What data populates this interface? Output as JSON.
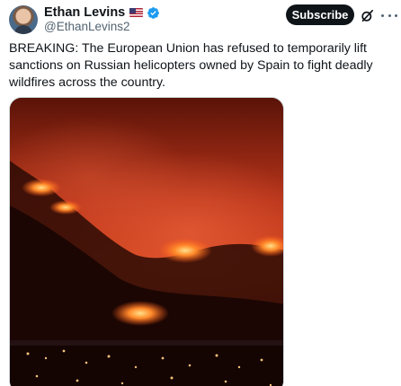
{
  "author": {
    "display_name": "Ethan Levins",
    "handle": "@EthanLevins2",
    "flag_icon": "us-flag-icon",
    "verified_icon": "verified-badge-icon",
    "verified_color": "#1d9bf0"
  },
  "actions": {
    "subscribe_label": "Subscribe",
    "grok_icon": "grok-icon",
    "more_icon": "more-options-icon"
  },
  "tweet": {
    "text": "BREAKING: The European Union has refused to temporarily lift sanctions on Russian helicopters owned by Spain to fight deadly wildfires across the country."
  },
  "media": {
    "type": "video-thumbnail",
    "subject": "wildfire-on-hillside-at-night"
  }
}
